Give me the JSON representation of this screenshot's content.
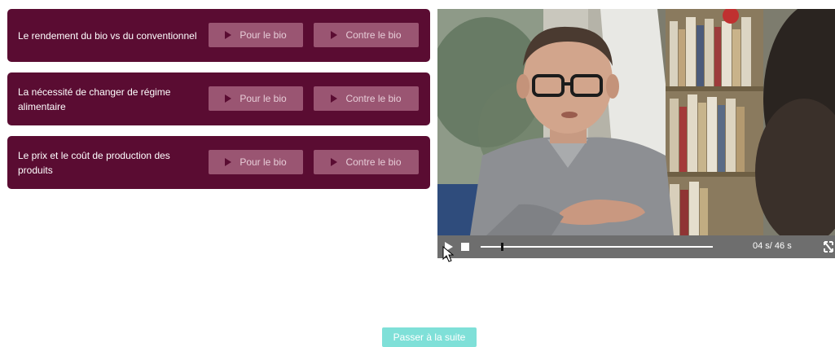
{
  "topics": [
    {
      "label": "Le rendement du bio vs du conventionnel",
      "pour_label": "Pour le bio",
      "contre_label": "Contre le bio"
    },
    {
      "label": "La nécessité de changer de régime alimentaire",
      "pour_label": "Pour le bio",
      "contre_label": "Contre le bio"
    },
    {
      "label": "Le prix et le coût de production des produits",
      "pour_label": "Pour le bio",
      "contre_label": "Contre le bio"
    }
  ],
  "video": {
    "time_display": "04 s/ 46 s",
    "progress": 0.087,
    "icons": {
      "play": "play-icon",
      "stop": "stop-icon",
      "fullscreen": "fullscreen-icon"
    }
  },
  "next_button": {
    "label": "Passer à la suite"
  },
  "colors": {
    "topic_bg": "#5a0c32",
    "topic_button": "#9a5572",
    "next_button": "#7fe0d8"
  }
}
